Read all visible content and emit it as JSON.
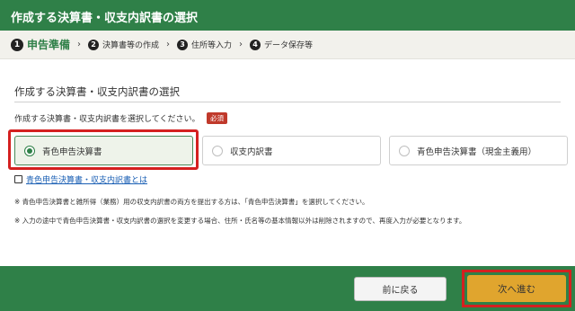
{
  "window": {
    "title": "作成する決算書・収支内訳書の選択"
  },
  "stepper": {
    "steps": [
      {
        "num": "1",
        "label": "申告準備",
        "active": true
      },
      {
        "num": "2",
        "label": "決算書等の作成",
        "active": false
      },
      {
        "num": "3",
        "label": "住所等入力",
        "active": false
      },
      {
        "num": "4",
        "label": "データ保存等",
        "active": false
      }
    ],
    "separator": "›"
  },
  "section": {
    "title": "作成する決算書・収支内訳書の選択",
    "instruction": "作成する決算書・収支内訳書を選択してください。",
    "required_badge": "必須"
  },
  "options": [
    {
      "label": "青色申告決算書",
      "selected": true
    },
    {
      "label": "収支内訳書",
      "selected": false
    },
    {
      "label": "青色申告決算書（現金主義用）",
      "selected": false
    }
  ],
  "help_link": "青色申告決算書・収支内訳書とは",
  "notes": [
    "※ 青色申告決算書と雑所得（業務）用の収支内訳書の両方を提出する方は、「青色申告決算書」を選択してください。",
    "※ 入力の途中で青色申告決算書・収支内訳書の選択を変更する場合、住所・氏名等の基本情報以外は削除されますので、再度入力が必要となります。"
  ],
  "footer": {
    "back_label": "前に戻る",
    "next_label": "次へ進む"
  },
  "colors": {
    "brand_green": "#2f8048",
    "next_button": "#e0a52e",
    "highlight": "#d42020",
    "link": "#1a5fb4"
  }
}
